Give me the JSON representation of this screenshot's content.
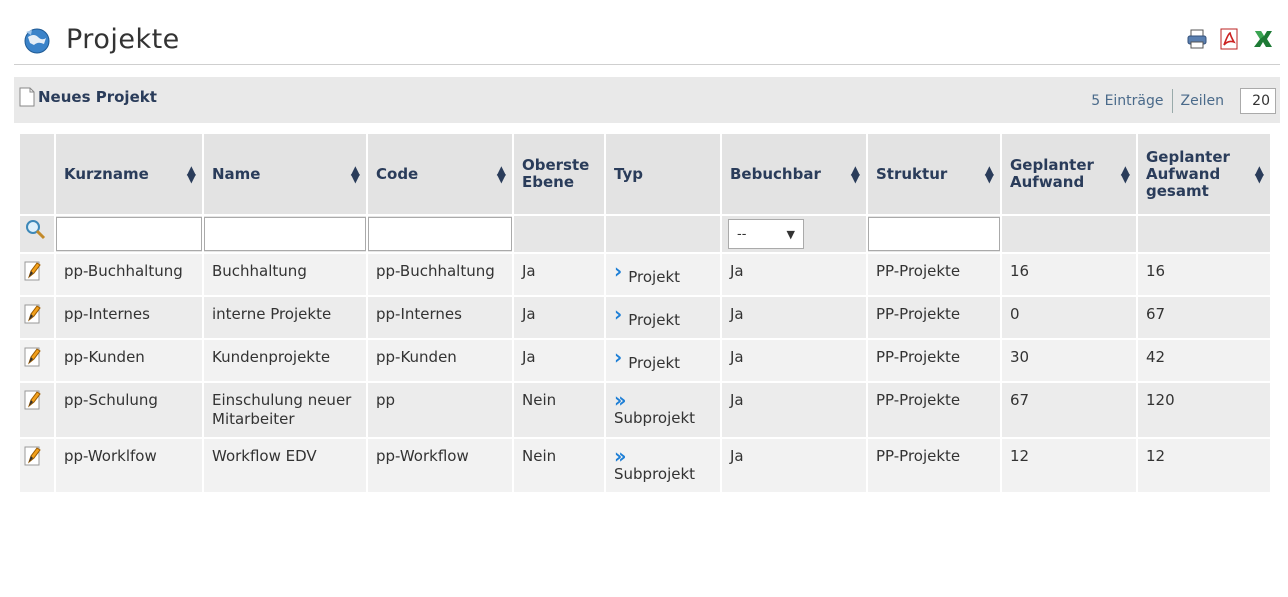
{
  "header": {
    "title": "Projekte"
  },
  "toolbar": {
    "new_project_label": "Neues Projekt",
    "entries_label": "5 Einträge",
    "rows_label": "Zeilen",
    "rows_value": "20"
  },
  "table": {
    "columns": [
      "Kurzname",
      "Name",
      "Code",
      "Oberste Ebene",
      "Typ",
      "Bebuchbar",
      "Struktur",
      "Geplanter Aufwand",
      "Geplanter Aufwand gesamt"
    ],
    "filter_select_value": "--",
    "rows": [
      {
        "kurzname": "pp-Buchhaltung",
        "name": "Buchhaltung",
        "code": "pp-Buchhaltung",
        "oberste": "Ja",
        "typ": "Projekt",
        "bebuchbar": "Ja",
        "struktur": "PP-Projekte",
        "aufwand": "16",
        "gesamt": "16"
      },
      {
        "kurzname": "pp-Internes",
        "name": "interne Projekte",
        "code": "pp-Internes",
        "oberste": "Ja",
        "typ": "Projekt",
        "bebuchbar": "Ja",
        "struktur": "PP-Projekte",
        "aufwand": "0",
        "gesamt": "67"
      },
      {
        "kurzname": "pp-Kunden",
        "name": "Kundenprojekte",
        "code": "pp-Kunden",
        "oberste": "Ja",
        "typ": "Projekt",
        "bebuchbar": "Ja",
        "struktur": "PP-Projekte",
        "aufwand": "30",
        "gesamt": "42"
      },
      {
        "kurzname": "pp-Schulung",
        "name": "Einschulung neuer Mitarbeiter",
        "code": "pp",
        "oberste": "Nein",
        "typ": "Subprojekt",
        "bebuchbar": "Ja",
        "struktur": "PP-Projekte",
        "aufwand": "67",
        "gesamt": "120"
      },
      {
        "kurzname": "pp-Worklfow",
        "name": "Workflow EDV",
        "code": "pp-Workflow",
        "oberste": "Nein",
        "typ": "Subprojekt",
        "bebuchbar": "Ja",
        "struktur": "PP-Projekte",
        "aufwand": "12",
        "gesamt": "12"
      }
    ]
  },
  "icons": {
    "logo": "globe-icon",
    "print": "printer-icon",
    "pdf": "pdf-icon",
    "excel": "excel-icon",
    "new": "new-document-icon",
    "search": "magnifier-icon",
    "edit": "pencil-icon",
    "typ_projekt": "single-chevron-icon",
    "typ_subprojekt": "double-chevron-icon"
  },
  "colors": {
    "accent": "#1e7fd6",
    "header_text": "#2a3c5a",
    "pager_text": "#4a6a8a"
  }
}
